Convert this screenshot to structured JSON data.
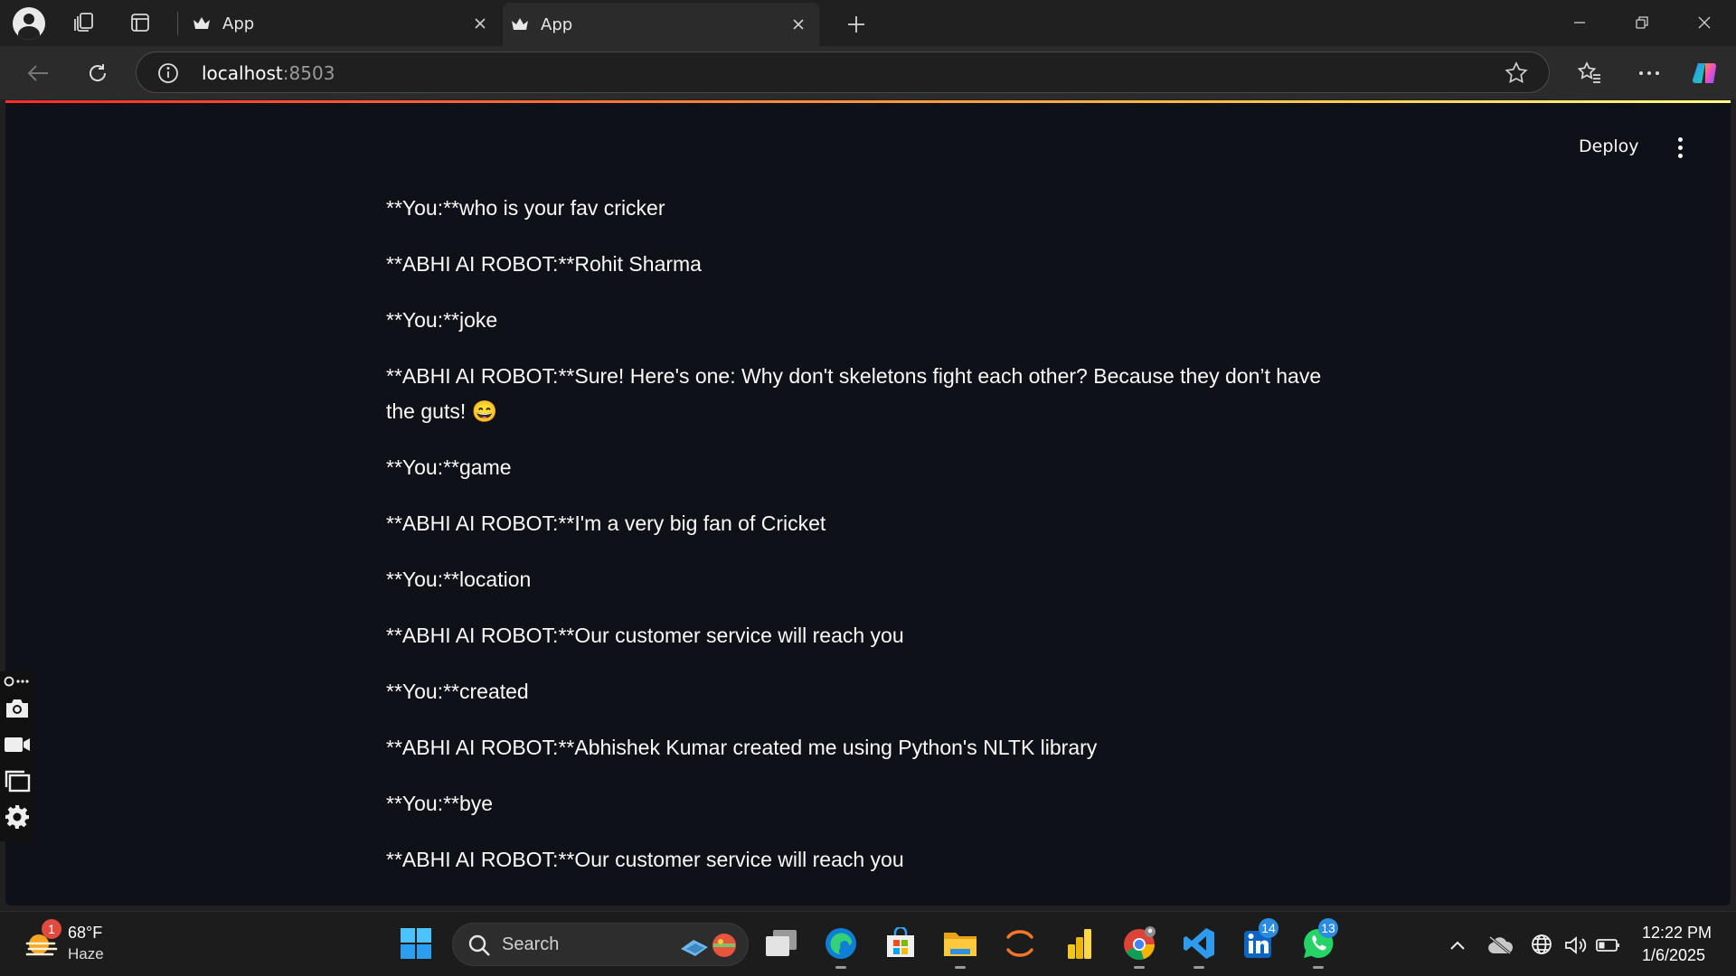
{
  "browser": {
    "tabs": [
      {
        "label": "App",
        "active": false
      },
      {
        "label": "App",
        "active": true
      }
    ],
    "address": {
      "host": "localhost",
      "port": ":8503"
    }
  },
  "app": {
    "deploy_label": "Deploy",
    "messages": [
      "**You:**who is your fav cricker",
      "**ABHI AI ROBOT:**Rohit Sharma",
      "**You:**joke",
      "**ABHI AI ROBOT:**Sure! Here's one: Why don't skeletons fight each other? Because they don’t have the guts! 😄",
      "**You:**game",
      "**ABHI AI ROBOT:**I'm a very big fan of Cricket",
      "**You:**location",
      "**ABHI AI ROBOT:**Our customer service will reach you",
      "**You:**created",
      "**ABHI AI ROBOT:**Abhishek Kumar created me using Python's NLTK library",
      "**You:**bye",
      "**ABHI AI ROBOT:**Our customer service will reach you"
    ]
  },
  "taskbar": {
    "weather": {
      "temp": "68°F",
      "condition": "Haze",
      "badge": "1"
    },
    "search_placeholder": "Search",
    "linkedin_badge": "14",
    "whatsapp_badge": "13",
    "clock": {
      "time": "12:22 PM",
      "date": "1/6/2025"
    }
  },
  "colors": {
    "page_bg": "#0e1117",
    "chrome_bg": "#202020",
    "toolbar_bg": "#2b2b2b",
    "accent_red": "#ff2b2b",
    "accent_yellow": "#ffbd45"
  }
}
